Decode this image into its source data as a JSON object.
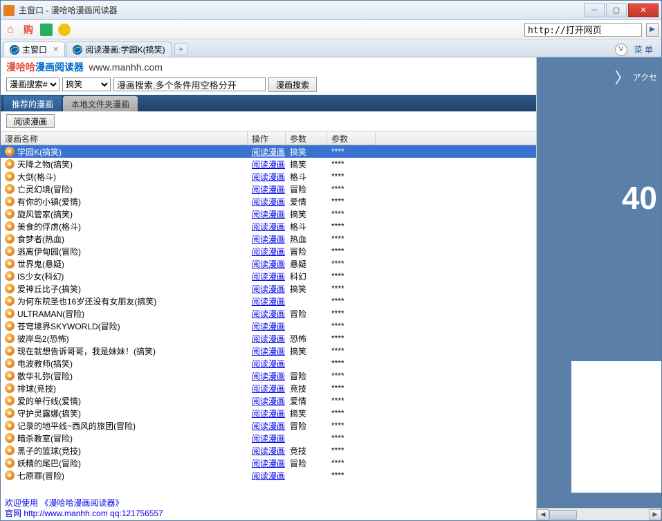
{
  "window": {
    "title": "主窗口 - 漫哈哈漫画阅读器"
  },
  "toolbar": {
    "url_value": "http://打开网页",
    "buy_label": "购"
  },
  "tabs": {
    "items": [
      {
        "label": "主窗口",
        "closable": true,
        "active": true
      },
      {
        "label": "阅读漫画:学园K(搞笑)",
        "closable": false,
        "active": false
      }
    ],
    "menu_label": "菜 单"
  },
  "brand": {
    "part1": "漫哈哈",
    "part2": "漫画阅读器",
    "url": "www.manhh.com"
  },
  "search": {
    "type_select": "漫画搜索#",
    "category_select": "搞笑",
    "placeholder": "漫画搜索,多个条件用空格分开",
    "button": "漫画搜索"
  },
  "viewtabs": {
    "active": "推荐的漫画",
    "inactive": "本地文件夹漫画"
  },
  "subbar": {
    "read_button": "阅读漫画"
  },
  "table": {
    "headers": {
      "c1": "漫画名称",
      "c2": "操作",
      "c3": "参数",
      "c4": "参数"
    },
    "action_label": "阅读漫画",
    "stars": "****",
    "rows": [
      {
        "name": "学园K(搞笑)",
        "cat": "搞笑",
        "selected": true
      },
      {
        "name": "天降之物(搞笑)",
        "cat": "搞笑"
      },
      {
        "name": "大剑(格斗)",
        "cat": "格斗"
      },
      {
        "name": "亡灵幻境(冒险)",
        "cat": "冒险"
      },
      {
        "name": "有你的小镇(爱情)",
        "cat": "爱情"
      },
      {
        "name": "旋风管家(搞笑)",
        "cat": "搞笑"
      },
      {
        "name": "美食的俘虏(格斗)",
        "cat": "格斗"
      },
      {
        "name": "食梦者(热血)",
        "cat": "热血"
      },
      {
        "name": "逃离伊甸园(冒险)",
        "cat": "冒险"
      },
      {
        "name": "世界鬼(悬疑)",
        "cat": "悬疑"
      },
      {
        "name": "IS少女(科幻)",
        "cat": "科幻"
      },
      {
        "name": "爱神丘比子(搞笑)",
        "cat": "搞笑"
      },
      {
        "name": "为何东院圣也16岁还没有女朋友(搞笑)",
        "cat": ""
      },
      {
        "name": "ULTRAMAN(冒险)",
        "cat": "冒险"
      },
      {
        "name": "苍穹境界SKYWORLD(冒险)",
        "cat": ""
      },
      {
        "name": "彼岸岛2(恐怖)",
        "cat": "恐怖"
      },
      {
        "name": "现在就想告诉哥哥，我是妹妹！(搞笑)",
        "cat": "搞笑"
      },
      {
        "name": "电波教师(搞笑)",
        "cat": ""
      },
      {
        "name": "散华礼弥(冒险)",
        "cat": "冒险"
      },
      {
        "name": "排球(竞技)",
        "cat": "竞技"
      },
      {
        "name": "爱的单行线(爱情)",
        "cat": "爱情"
      },
      {
        "name": "守护灵露娜(搞笑)",
        "cat": "搞笑"
      },
      {
        "name": "记录的地平线~西风的旅团(冒险)",
        "cat": "冒险"
      },
      {
        "name": "暗杀教室(冒险)",
        "cat": ""
      },
      {
        "name": "黑子的篮球(竞技)",
        "cat": "竞技"
      },
      {
        "name": "妖精的尾巴(冒险)",
        "cat": "冒险"
      },
      {
        "name": "七原罪(冒险)",
        "cat": ""
      }
    ]
  },
  "footer": {
    "line1": "欢迎使用 《漫哈哈漫画阅读器》",
    "line2": "官网 http://www.manhh.com qq:121756557"
  },
  "sidepanel": {
    "header_text": "アクセ",
    "big_text": "40"
  }
}
